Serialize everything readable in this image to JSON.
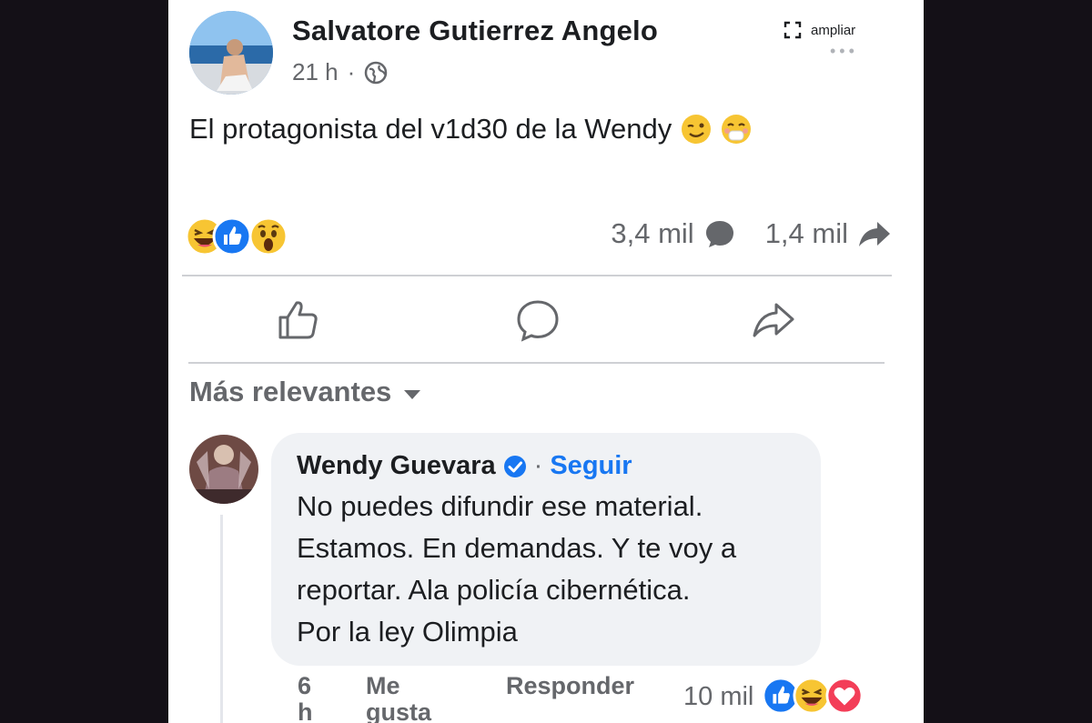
{
  "post": {
    "author": "Salvatore Gutierrez Angelo",
    "time": "21 h",
    "separator": "·",
    "expand_label": "ampliar",
    "more_dots": "•••",
    "text": "El protagonista del v1d30 de la Wendy",
    "text_emojis": [
      "wink-face-emoji",
      "blushing-face-emoji"
    ],
    "reactions": [
      "haha-reaction-icon",
      "like-reaction-icon",
      "wow-reaction-icon"
    ],
    "comment_count": "3,4 mil",
    "share_count": "1,4 mil"
  },
  "sort": {
    "label": "Más relevantes"
  },
  "comment": {
    "author": "Wendy Guevara",
    "separator": "·",
    "follow_label": "Seguir",
    "lines": [
      "No puedes difundir ese material.",
      "Estamos. En demandas. Y te voy a",
      "reportar. Ala policía cibernética.",
      "Por la ley Olimpia"
    ],
    "time_lines": [
      "6",
      "h"
    ],
    "like_lines": [
      "Me",
      "gusta"
    ],
    "reply_label": "Responder",
    "reaction_count": "10 mil",
    "reactions": [
      "like-reaction-icon",
      "haha-reaction-icon",
      "love-reaction-icon"
    ]
  },
  "colors": {
    "facebook_blue": "#1877f2",
    "secondary_text": "#65676b",
    "bubble": "#f0f2f5",
    "page_background": "#141017"
  }
}
